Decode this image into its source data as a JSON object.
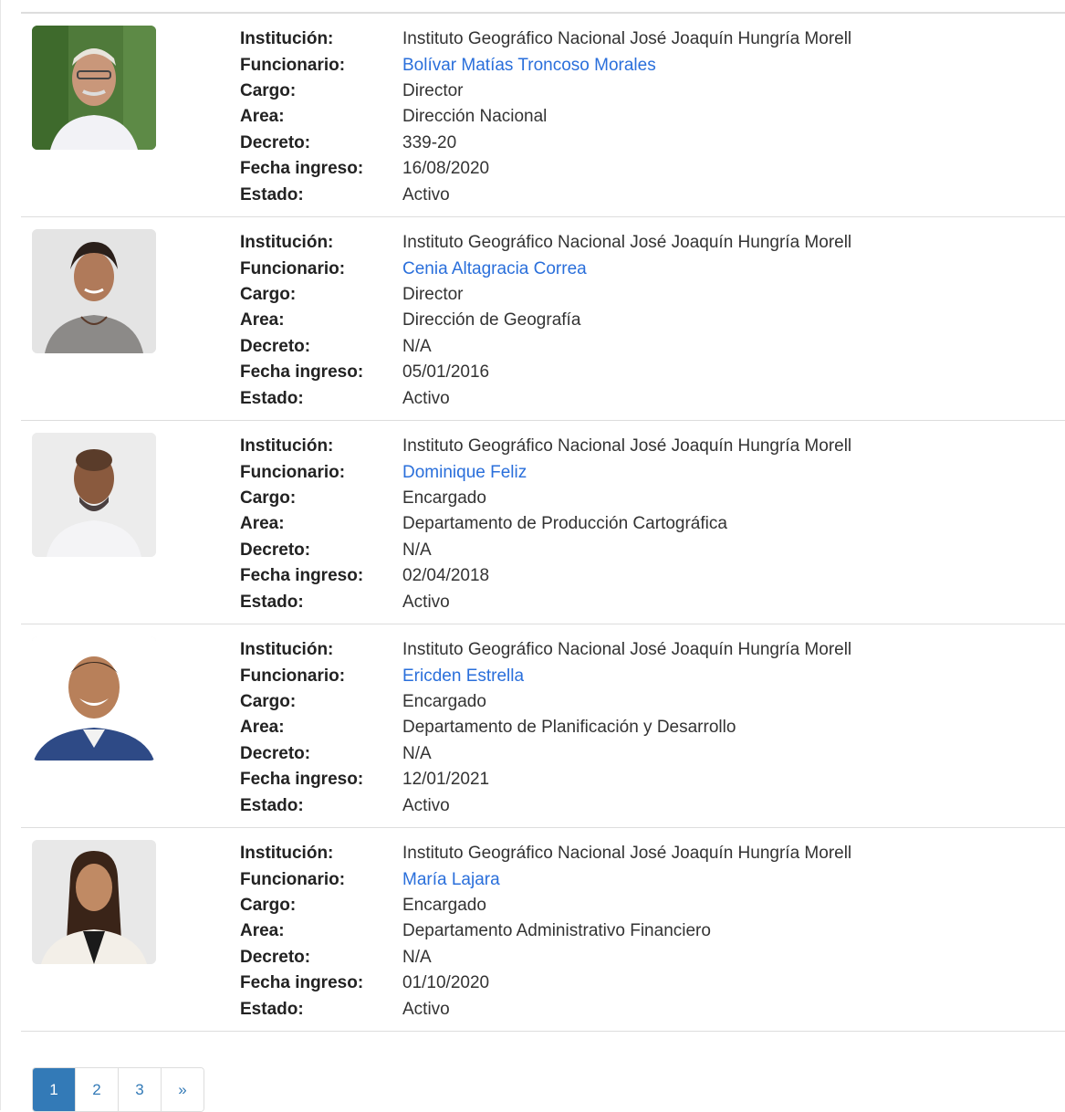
{
  "labels": {
    "institucion": "Institución:",
    "funcionario": "Funcionario:",
    "cargo": "Cargo:",
    "area": "Area:",
    "decreto": "Decreto:",
    "fecha_ingreso": "Fecha ingreso:",
    "estado": "Estado:"
  },
  "records": [
    {
      "institucion": "Instituto Geográfico Nacional José Joaquín Hungría Morell",
      "funcionario": "Bolívar Matías Troncoso Morales",
      "cargo": "Director",
      "area": "Dirección Nacional",
      "decreto": "339-20",
      "fecha_ingreso": "16/08/2020",
      "estado": "Activo"
    },
    {
      "institucion": "Instituto Geográfico Nacional José Joaquín Hungría Morell",
      "funcionario": "Cenia Altagracia Correa",
      "cargo": "Director",
      "area": "Dirección de Geografía",
      "decreto": "N/A",
      "fecha_ingreso": "05/01/2016",
      "estado": "Activo"
    },
    {
      "institucion": "Instituto Geográfico Nacional José Joaquín Hungría Morell",
      "funcionario": "Dominique Feliz",
      "cargo": "Encargado",
      "area": "Departamento de Producción Cartográfica",
      "decreto": "N/A",
      "fecha_ingreso": "02/04/2018",
      "estado": "Activo"
    },
    {
      "institucion": "Instituto Geográfico Nacional José Joaquín Hungría Morell",
      "funcionario": "Ericden Estrella",
      "cargo": "Encargado",
      "area": "Departamento de Planificación y Desarrollo",
      "decreto": "N/A",
      "fecha_ingreso": "12/01/2021",
      "estado": "Activo"
    },
    {
      "institucion": "Instituto Geográfico Nacional José Joaquín Hungría Morell",
      "funcionario": "María Lajara",
      "cargo": "Encargado",
      "area": "Departamento Administrativo Financiero",
      "decreto": "N/A",
      "fecha_ingreso": "01/10/2020",
      "estado": "Activo"
    }
  ],
  "pagination": {
    "pages": [
      "1",
      "2",
      "3"
    ],
    "active": "1",
    "next": "»"
  },
  "colors": {
    "link": "#2a6fdb",
    "pagination_active": "#337ab7",
    "divider": "#dddddd"
  }
}
